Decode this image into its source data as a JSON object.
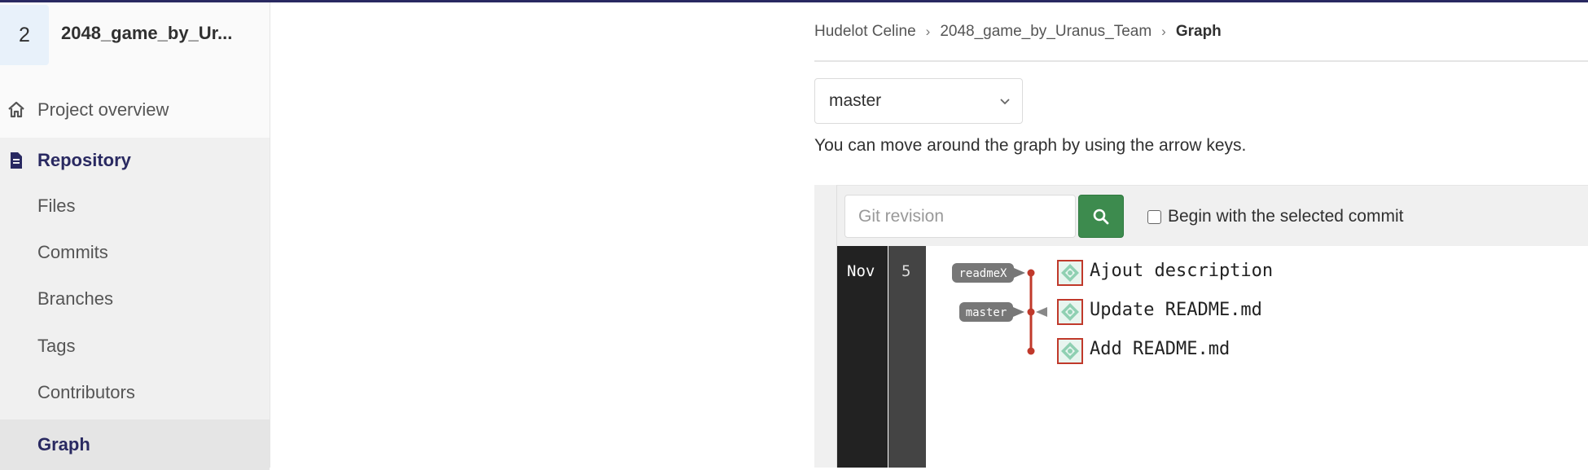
{
  "sidebar": {
    "project_avatar": "2",
    "project_name": "2048_game_by_Ur...",
    "overview_label": "Project overview",
    "repository_label": "Repository",
    "sub_items": [
      {
        "label": "Files"
      },
      {
        "label": "Commits"
      },
      {
        "label": "Branches"
      },
      {
        "label": "Tags"
      },
      {
        "label": "Contributors"
      },
      {
        "label": "Graph"
      }
    ]
  },
  "breadcrumb": {
    "items": [
      "Hudelot Celine",
      "2048_game_by_Uranus_Team"
    ],
    "current": "Graph"
  },
  "branch_select": {
    "value": "master"
  },
  "hint": "You can move around the graph by using the arrow keys.",
  "graph_toolbar": {
    "revision_placeholder": "Git revision",
    "begin_with_selected_label": "Begin with the selected commit"
  },
  "graph": {
    "month": "Nov",
    "day": "5",
    "commits": [
      {
        "message": "Ajout description",
        "label": "readmeX"
      },
      {
        "message": "Update README.md",
        "label": "master"
      },
      {
        "message": "Add README.md",
        "label": ""
      }
    ]
  },
  "colors": {
    "accent": "#292961",
    "search_button": "#3d8b4e",
    "graph_line": "#c0392b"
  }
}
